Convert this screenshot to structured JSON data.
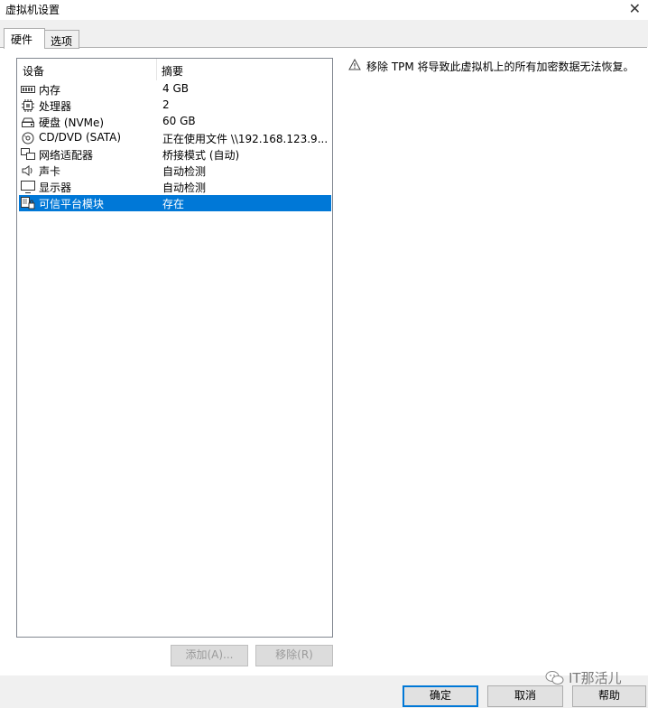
{
  "window": {
    "title": "虚拟机设置"
  },
  "tabs": [
    {
      "label": "硬件",
      "active": true
    },
    {
      "label": "选项",
      "active": false
    }
  ],
  "device_list": {
    "columns": {
      "device": "设备",
      "summary": "摘要"
    },
    "rows": [
      {
        "icon": "memory-icon",
        "name": "内存",
        "summary": "4 GB"
      },
      {
        "icon": "cpu-icon",
        "name": "处理器",
        "summary": "2"
      },
      {
        "icon": "disk-icon",
        "name": "硬盘 (NVMe)",
        "summary": "60 GB"
      },
      {
        "icon": "cd-icon",
        "name": "CD/DVD (SATA)",
        "summary": "正在使用文件 \\\\192.168.123.9..."
      },
      {
        "icon": "network-icon",
        "name": "网络适配器",
        "summary": "桥接模式 (自动)"
      },
      {
        "icon": "sound-icon",
        "name": "声卡",
        "summary": "自动检测"
      },
      {
        "icon": "display-icon",
        "name": "显示器",
        "summary": "自动检测"
      },
      {
        "icon": "tpm-icon",
        "name": "可信平台模块",
        "summary": "存在",
        "selected": true
      }
    ]
  },
  "buttons": {
    "add": "添加(A)...",
    "remove": "移除(R)",
    "ok": "确定",
    "cancel": "取消",
    "help": "帮助"
  },
  "warning": {
    "icon": "warning-icon",
    "text": "移除 TPM 将导致此虚拟机上的所有加密数据无法恢复。"
  },
  "watermark": {
    "text": "IT那活儿"
  },
  "colors": {
    "selection": "#0078d7",
    "accent": "#0078d7"
  }
}
